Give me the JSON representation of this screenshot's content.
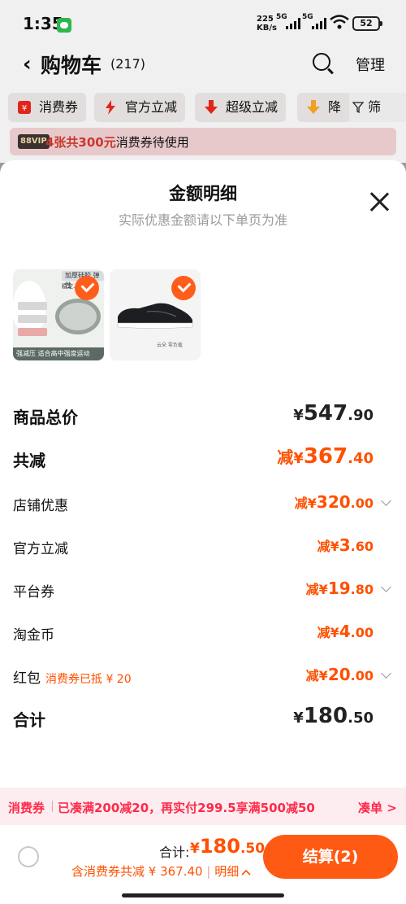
{
  "status_bar": {
    "time": "1:35",
    "net_speed_top": "225",
    "net_speed_bottom": "KB/s",
    "sig1": "5G",
    "sig2": "5G",
    "battery": "52"
  },
  "nav": {
    "back_icon": "chevron-left-icon",
    "title": "购物车",
    "count": "(217)",
    "manage": "管理"
  },
  "filters": {
    "chips": [
      {
        "label": "消费券",
        "icon": "coupon-icon"
      },
      {
        "label": "官方立减",
        "icon": "lightning-icon"
      },
      {
        "label": "超级立减",
        "icon": "down-arrow-icon"
      },
      {
        "label": "降",
        "icon": "down-arrow-icon"
      }
    ],
    "filter_label": "筛选"
  },
  "coupon_banner": {
    "vip": "88VIP",
    "highlight": "4张共300元",
    "text": "消费券待使用"
  },
  "sheet": {
    "title": "金额明细",
    "subtitle": "实际优惠金额请以下单页为准",
    "thumb1": {
      "badge": "加厚硅胶 弹性",
      "sub": "稳定…",
      "footer": "强减压 适合高中强度运动"
    },
    "thumb2": {
      "caption": "云朵 零负载"
    }
  },
  "breakdown": {
    "total_price": {
      "label": "商品总价",
      "prefix": "",
      "yen": "¥",
      "integer": "547",
      "decimal": ".90"
    },
    "total_discount": {
      "label": "共减",
      "prefix": "减",
      "yen": "¥",
      "integer": "367",
      "decimal": ".40"
    },
    "shop_discount": {
      "label": "店铺优惠",
      "prefix": "减",
      "yen": "¥",
      "integer": "320",
      "decimal": ".00"
    },
    "official_discount": {
      "label": "官方立减",
      "prefix": "减",
      "yen": "¥",
      "integer": "3",
      "decimal": ".60"
    },
    "platform_coupon": {
      "label": "平台券",
      "prefix": "减",
      "yen": "¥",
      "integer": "19",
      "decimal": ".80"
    },
    "taojinbi": {
      "label": "淘金币",
      "prefix": "减",
      "yen": "¥",
      "integer": "4",
      "decimal": ".00"
    },
    "red_packet": {
      "label": "红包",
      "sub_label": "消费券已抵 ¥ 20",
      "prefix": "减",
      "yen": "¥",
      "integer": "20",
      "decimal": ".00"
    },
    "grand_total": {
      "label": "合计",
      "prefix": "",
      "yen": "¥",
      "integer": "180",
      "decimal": ".50"
    }
  },
  "promo": {
    "tag": "消费券",
    "text": "已凑满200减20，再实付299.5享满500减50",
    "link": "凑单 >"
  },
  "bottom_bar": {
    "total_label": "合计:",
    "yen": "¥",
    "integer": "180",
    "decimal": ".50",
    "sub": "含消费券共减 ¥ 367.40",
    "detail": "明细",
    "checkout": "结算(2)"
  }
}
